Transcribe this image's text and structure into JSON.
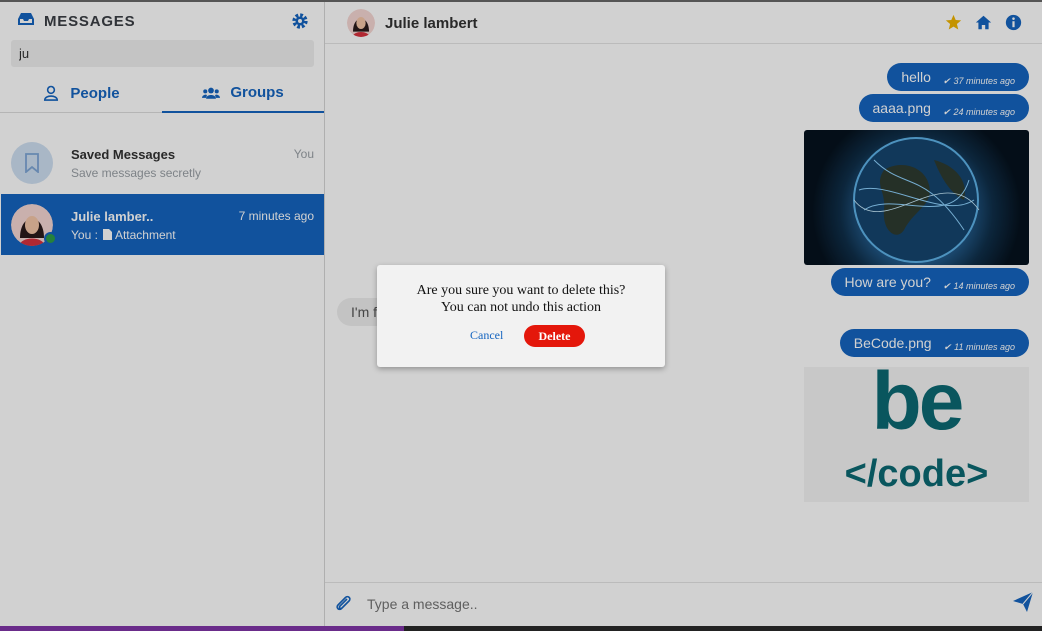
{
  "sidebar": {
    "title": "MESSAGES",
    "search_value": "ju",
    "tabs": [
      {
        "label": "People",
        "icon": "user-icon"
      },
      {
        "label": "Groups",
        "icon": "users-icon"
      }
    ],
    "conversations": [
      {
        "name": "Saved Messages",
        "subtitle": "Save messages secretly",
        "time": "You"
      },
      {
        "name": "Julie lamber..",
        "prefix": "You :",
        "subtitle": "Attachment",
        "time": "7 minutes ago"
      }
    ]
  },
  "chat": {
    "contact_name": "Julie lambert",
    "messages": [
      {
        "text": "hello",
        "time": "37 minutes ago"
      },
      {
        "text": "aaaa.png",
        "time": "24 minutes ago"
      },
      {
        "text": "How are you?",
        "time": "14 minutes ago"
      },
      {
        "text": "BeCode.png",
        "time": "11 minutes ago"
      }
    ],
    "incoming_text": "I'm fin thank",
    "becode_logo_top": "be",
    "becode_logo_bottom": "</code>",
    "input_placeholder": "Type a message.."
  },
  "dialog": {
    "line1": "Are you sure you want to delete this?",
    "line2": "You can not undo this action",
    "cancel_label": "Cancel",
    "delete_label": "Delete"
  },
  "colors": {
    "primary": "#1565c0",
    "danger": "#e4170b",
    "online": "#2e9e48",
    "star": "#f0b400",
    "becode_teal": "#0c6a73"
  }
}
